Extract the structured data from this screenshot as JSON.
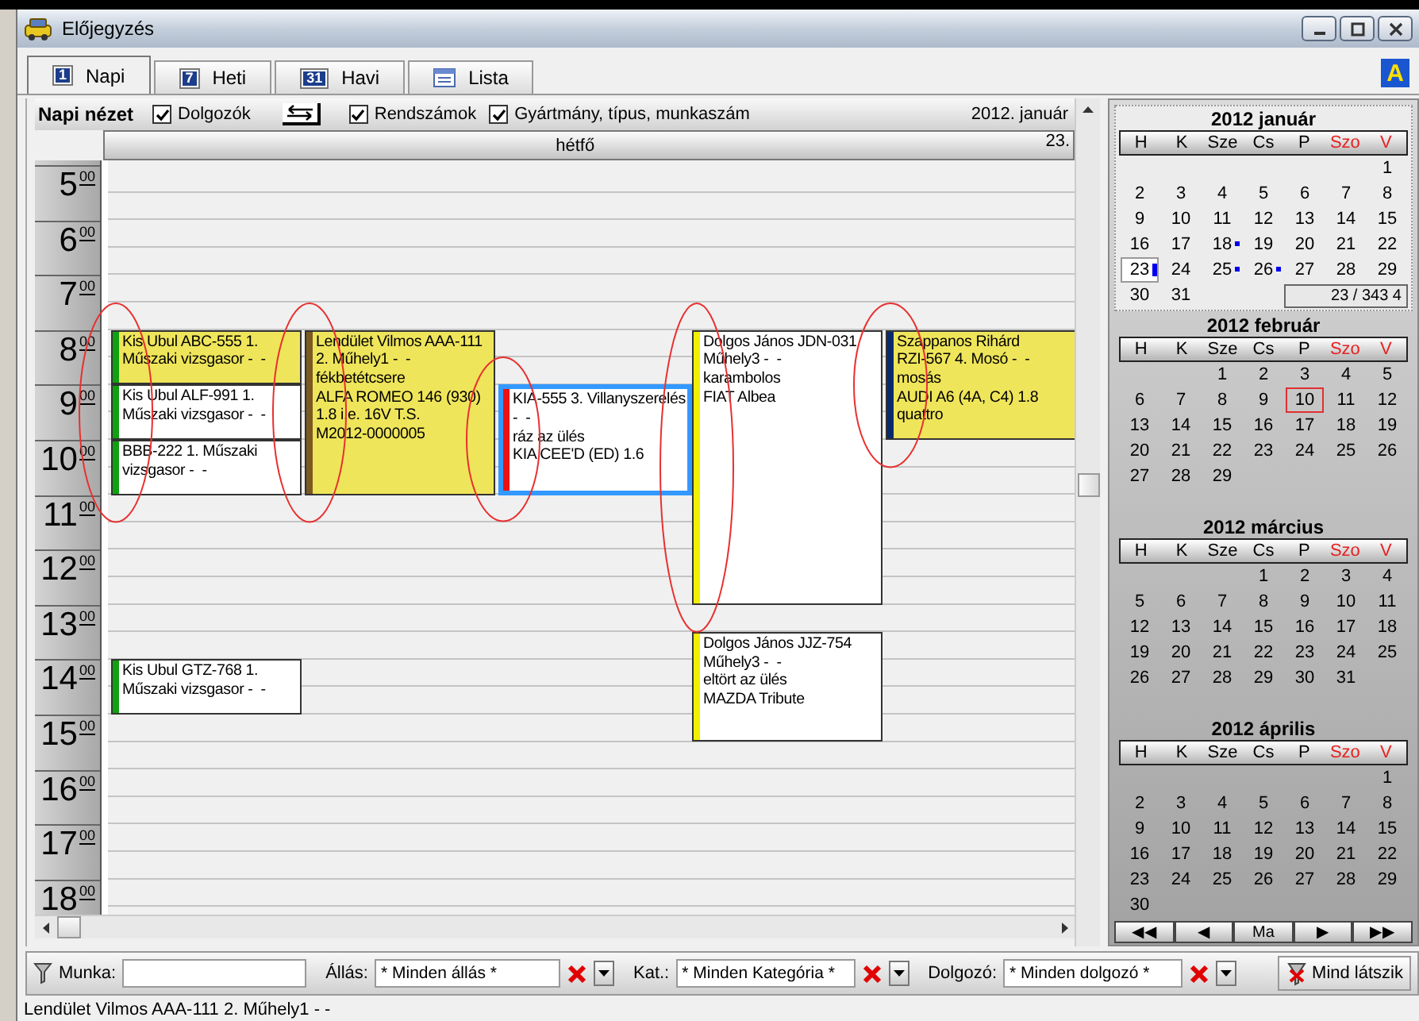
{
  "window": {
    "title": "Előjegyzés"
  },
  "tabs": [
    {
      "label": "Napi",
      "icon_text": "1",
      "selected": true
    },
    {
      "label": "Heti",
      "icon_text": "7",
      "selected": false
    },
    {
      "label": "Havi",
      "icon_text": "31",
      "selected": false
    },
    {
      "label": "Lista",
      "selected": false
    }
  ],
  "corner_badge": "A",
  "toolbar": {
    "title": "Napi nézet",
    "items": [
      {
        "kind": "checkbox",
        "label": "Dolgozók",
        "checked": true
      },
      {
        "kind": "swap"
      },
      {
        "kind": "checkbox",
        "label": "Rendszámok",
        "checked": true
      },
      {
        "kind": "checkbox",
        "label": "Gyártmány, típus, munkaszám",
        "checked": true
      }
    ],
    "period": "2012. január"
  },
  "day_header": {
    "weekday": "hétfő",
    "date": "23."
  },
  "hours": [
    {
      "hour": "5",
      "minutes": "00"
    },
    {
      "hour": "6",
      "minutes": "00"
    },
    {
      "hour": "7",
      "minutes": "00"
    },
    {
      "hour": "8",
      "minutes": "00"
    },
    {
      "hour": "9",
      "minutes": "00"
    },
    {
      "hour": "10",
      "minutes": "00"
    },
    {
      "hour": "11",
      "minutes": "00"
    },
    {
      "hour": "12",
      "minutes": "00"
    },
    {
      "hour": "13",
      "minutes": "00"
    },
    {
      "hour": "14",
      "minutes": "00"
    },
    {
      "hour": "15",
      "minutes": "00"
    },
    {
      "hour": "16",
      "minutes": "00"
    },
    {
      "hour": "17",
      "minutes": "00"
    },
    {
      "hour": "18",
      "minutes": "00"
    }
  ],
  "lanes": [
    {
      "circled": true,
      "slots": [
        {
          "kind": "free"
        },
        {
          "kind": "free"
        },
        {
          "kind": "free"
        },
        {
          "kind": "free"
        },
        {
          "kind": "free"
        },
        {
          "kind": "free"
        },
        {
          "kind": "appointment",
          "color": "#10a010",
          "highlighted": true,
          "selected": false,
          "lines": [
            "Kis Ubul ABC-555 1.",
            "Műszaki vizsgasor -  -"
          ]
        },
        {
          "kind": "continued"
        },
        {
          "kind": "appointment",
          "color": "#10a010",
          "highlighted": false,
          "selected": false,
          "lines": [
            "Kis Ubul ALF-991 1.",
            "Műszaki vizsgasor -  -"
          ]
        },
        {
          "kind": "continued"
        },
        {
          "kind": "appointment",
          "color": "#10a010",
          "highlighted": false,
          "selected": false,
          "lines": [
            "BBB-222 1. Műszaki",
            "vizsgasor -  -"
          ]
        },
        {
          "kind": "continued"
        },
        {
          "kind": "free"
        },
        {
          "kind": "free"
        },
        {
          "kind": "free"
        },
        {
          "kind": "free"
        },
        {
          "kind": "free"
        },
        {
          "kind": "free"
        },
        {
          "kind": "appointment",
          "color": "#10a010",
          "highlighted": false,
          "selected": false,
          "lines": [
            "Kis Ubul GTZ-768 1.",
            "Műszaki vizsgasor -  -"
          ]
        },
        {
          "kind": "continued"
        }
      ]
    },
    {
      "circled": true,
      "slots": [
        {
          "kind": "free"
        },
        {
          "kind": "free"
        },
        {
          "kind": "free"
        },
        {
          "kind": "free"
        },
        {
          "kind": "free"
        },
        {
          "kind": "free"
        },
        {
          "kind": "appointment",
          "color": "#7a5a20",
          "highlighted": true,
          "selected": false,
          "lines": [
            "Lendület Vilmos AAA-111",
            "2. Műhely1 -  -",
            "fékbetétcsere",
            "ALFA ROMEO 146 (930)",
            "1.8 i.e. 16V T.S.",
            "M2012-0000005"
          ]
        },
        {
          "kind": "continued"
        },
        {
          "kind": "continued"
        },
        {
          "kind": "continued"
        },
        {
          "kind": "continued"
        },
        {
          "kind": "continued"
        }
      ]
    },
    {
      "circled": true,
      "slots": [
        {
          "kind": "free"
        },
        {
          "kind": "free"
        },
        {
          "kind": "free"
        },
        {
          "kind": "free"
        },
        {
          "kind": "free"
        },
        {
          "kind": "free"
        },
        {
          "kind": "free"
        },
        {
          "kind": "free"
        },
        {
          "kind": "appointment",
          "color": "#ee1010",
          "highlighted": false,
          "selected": true,
          "lines": [
            "KIA-555 3. Villanyszerelés",
            "-  -",
            "ráz az ülés",
            "KIA CEE'D (ED) 1.6"
          ]
        },
        {
          "kind": "continued"
        },
        {
          "kind": "continued"
        },
        {
          "kind": "continued"
        }
      ]
    },
    {
      "circled": true,
      "slots": [
        {
          "kind": "free"
        },
        {
          "kind": "free"
        },
        {
          "kind": "free"
        },
        {
          "kind": "free"
        },
        {
          "kind": "free"
        },
        {
          "kind": "free"
        },
        {
          "kind": "appointment",
          "color": "#f0f000",
          "highlighted": false,
          "selected": false,
          "lines": [
            "Dolgos János JDN-031",
            "Műhely3 -  -",
            "karambolos",
            "FIAT Albea"
          ]
        },
        {
          "kind": "continued"
        },
        {
          "kind": "continued"
        },
        {
          "kind": "continued"
        },
        {
          "kind": "continued"
        },
        {
          "kind": "continued"
        },
        {
          "kind": "continued"
        },
        {
          "kind": "continued"
        },
        {
          "kind": "continued"
        },
        {
          "kind": "continued"
        },
        {
          "kind": "free"
        },
        {
          "kind": "appointment",
          "color": "#f0f000",
          "highlighted": false,
          "selected": false,
          "lines": [
            "Dolgos János JJZ-754",
            "Műhely3 -  -",
            "eltört az ülés",
            "MAZDA Tribute"
          ]
        },
        {
          "kind": "continued"
        },
        {
          "kind": "continued"
        },
        {
          "kind": "continued"
        }
      ]
    },
    {
      "circled": true,
      "slots": [
        {
          "kind": "free"
        },
        {
          "kind": "free"
        },
        {
          "kind": "free"
        },
        {
          "kind": "free"
        },
        {
          "kind": "free"
        },
        {
          "kind": "free"
        },
        {
          "kind": "appointment",
          "color": "#0a2a6a",
          "highlighted": true,
          "selected": false,
          "lines": [
            "Szappanos Rihárd",
            "RZI-567 4. Mosó -  -",
            "mosás",
            "AUDI A6 (4A, C4) 1.8",
            "quattro"
          ]
        },
        {
          "kind": "continued"
        },
        {
          "kind": "continued"
        },
        {
          "kind": "continued"
        }
      ]
    }
  ],
  "calendar": {
    "months": [
      {
        "title": "2012 január",
        "selected": true,
        "info": "23 / 343  4",
        "weekdays": [
          {
            "label": "H",
            "weekend": false
          },
          {
            "label": "K",
            "weekend": false
          },
          {
            "label": "Sze",
            "weekend": false
          },
          {
            "label": "Cs",
            "weekend": false
          },
          {
            "label": "P",
            "weekend": false
          },
          {
            "label": "Szo",
            "weekend": true
          },
          {
            "label": "V",
            "weekend": true
          }
        ],
        "weeks": [
          [
            "1"
          ],
          [
            "2",
            "3",
            "4",
            "5",
            "6",
            "7",
            "8"
          ],
          [
            "9",
            "10",
            "11",
            "12",
            "13",
            "14",
            "15"
          ],
          [
            "16",
            "17",
            {
              "day": "18",
              "kind": "dot"
            },
            "19",
            "20",
            "21",
            "22"
          ],
          [
            {
              "day": "23",
              "selected": true,
              "kind": "bar"
            },
            "24",
            {
              "day": "25",
              "kind": "dot"
            },
            {
              "day": "26",
              "kind": "dot"
            },
            "27",
            "28",
            "29"
          ],
          [
            "30",
            "31"
          ]
        ]
      },
      {
        "title": "2012 február",
        "selected": false,
        "weekdays": [
          {
            "label": "H",
            "weekend": false
          },
          {
            "label": "K",
            "weekend": false
          },
          {
            "label": "Sze",
            "weekend": false
          },
          {
            "label": "Cs",
            "weekend": false
          },
          {
            "label": "P",
            "weekend": false
          },
          {
            "label": "Szo",
            "weekend": true
          },
          {
            "label": "V",
            "weekend": true
          }
        ],
        "weeks": [
          [
            "1",
            "2",
            "3",
            "4",
            "5"
          ],
          [
            "6",
            "7",
            "8",
            "9",
            {
              "day": "10",
              "today": true
            },
            "11",
            "12"
          ],
          [
            "13",
            "14",
            "15",
            "16",
            "17",
            "18",
            "19"
          ],
          [
            "20",
            "21",
            "22",
            "23",
            "24",
            "25",
            "26"
          ],
          [
            "27",
            "28",
            "29"
          ]
        ]
      },
      {
        "title": "2012 március",
        "selected": false,
        "weekdays": [
          {
            "label": "H",
            "weekend": false
          },
          {
            "label": "K",
            "weekend": false
          },
          {
            "label": "Sze",
            "weekend": false
          },
          {
            "label": "Cs",
            "weekend": false
          },
          {
            "label": "P",
            "weekend": false
          },
          {
            "label": "Szo",
            "weekend": true
          },
          {
            "label": "V",
            "weekend": true
          }
        ],
        "weeks": [
          [
            "1",
            "2",
            "3",
            "4"
          ],
          [
            "5",
            "6",
            "7",
            "8",
            "9",
            "10",
            "11"
          ],
          [
            "12",
            "13",
            "14",
            "15",
            "16",
            "17",
            "18"
          ],
          [
            "19",
            "20",
            "21",
            "22",
            "23",
            "24",
            "25"
          ],
          [
            "26",
            "27",
            "28",
            "29",
            "30",
            "31"
          ]
        ]
      },
      {
        "title": "2012 április",
        "selected": false,
        "weekdays": [
          {
            "label": "H",
            "weekend": false
          },
          {
            "label": "K",
            "weekend": false
          },
          {
            "label": "Sze",
            "weekend": false
          },
          {
            "label": "Cs",
            "weekend": false
          },
          {
            "label": "P",
            "weekend": false
          },
          {
            "label": "Szo",
            "weekend": true
          },
          {
            "label": "V",
            "weekend": true
          }
        ],
        "weeks": [
          [
            "1"
          ],
          [
            "2",
            "3",
            "4",
            "5",
            "6",
            "7",
            "8"
          ],
          [
            "9",
            "10",
            "11",
            "12",
            "13",
            "14",
            "15"
          ],
          [
            "16",
            "17",
            "18",
            "19",
            "20",
            "21",
            "22"
          ],
          [
            "23",
            "24",
            "25",
            "26",
            "27",
            "28",
            "29"
          ],
          [
            "30"
          ]
        ]
      }
    ],
    "nav": [
      "◀◀",
      "◀",
      "Ma",
      "▶",
      "▶▶"
    ]
  },
  "filters": {
    "work_label": "Munka:",
    "fields": [
      {
        "label": "Állás:",
        "value": "* Minden állás *"
      },
      {
        "label": "Kat.:",
        "value": "* Minden Kategória *"
      },
      {
        "label": "Dolgozó:",
        "value": "* Minden dolgozó *"
      }
    ],
    "button": "Mind látszik"
  },
  "status_bar": "Lendület Vilmos AAA-111 2. Műhely1 -  -"
}
